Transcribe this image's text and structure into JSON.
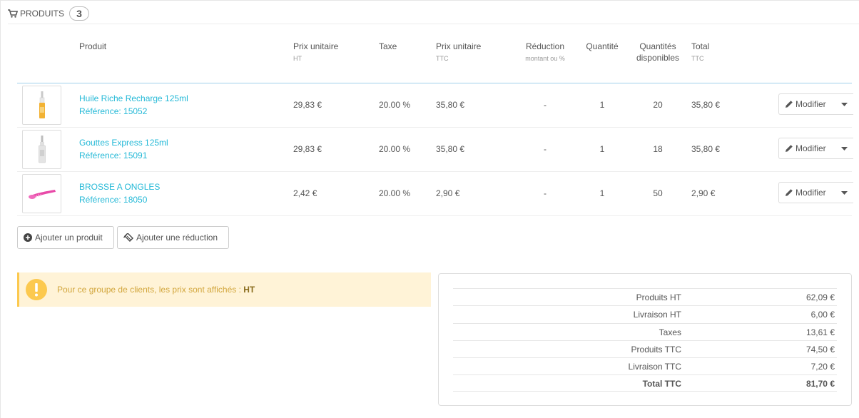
{
  "panel": {
    "title": "PRODUITS",
    "count": "3",
    "icon": "cart-icon"
  },
  "table": {
    "headers": {
      "product": "Produit",
      "unit_price_ht": "Prix unitaire",
      "unit_price_ht_sub": "HT",
      "tax": "Taxe",
      "unit_price_ttc": "Prix unitaire",
      "unit_price_ttc_sub": "TTC",
      "reduction": "Réduction",
      "reduction_sub": "montant ou %",
      "quantity": "Quantité",
      "available_line1": "Quantités",
      "available_line2": "disponibles",
      "total": "Total",
      "total_sub": "TTC"
    },
    "rows": [
      {
        "name": "Huile Riche Recharge 125ml",
        "reference": "Référence: 15052",
        "price_ht": "29,83 €",
        "tax": "20.00 %",
        "price_ttc": "35,80 €",
        "reduction": "-",
        "quantity": "1",
        "available": "20",
        "total": "35,80 €",
        "edit_label": "Modifier"
      },
      {
        "name": "Gouttes Express 125ml",
        "reference": "Référence: 15091",
        "price_ht": "29,83 €",
        "tax": "20.00 %",
        "price_ttc": "35,80 €",
        "reduction": "-",
        "quantity": "1",
        "available": "18",
        "total": "35,80 €",
        "edit_label": "Modifier"
      },
      {
        "name": "BROSSE A ONGLES",
        "reference": "Référence: 18050",
        "price_ht": "2,42 €",
        "tax": "20.00 %",
        "price_ttc": "2,90 €",
        "reduction": "-",
        "quantity": "1",
        "available": "50",
        "total": "2,90 €",
        "edit_label": "Modifier"
      }
    ]
  },
  "actions": {
    "add_product": "Ajouter un produit",
    "add_reduction": "Ajouter une réduction"
  },
  "alert": {
    "text": "Pour ce groupe de clients, les prix sont affichés :",
    "strong": "HT"
  },
  "totals": [
    {
      "label": "Produits HT",
      "value": "62,09 €"
    },
    {
      "label": "Livraison HT",
      "value": "6,00 €"
    },
    {
      "label": "Taxes",
      "value": "13,61 €"
    },
    {
      "label": "Produits TTC",
      "value": "74,50 €"
    },
    {
      "label": "Livraison TTC",
      "value": "7,20 €"
    },
    {
      "label": "Total TTC",
      "value": "81,70 €"
    }
  ],
  "colors": {
    "link": "#25b9d7",
    "alert_bg": "#fff3d7",
    "alert_icon": "#fcc94f"
  }
}
